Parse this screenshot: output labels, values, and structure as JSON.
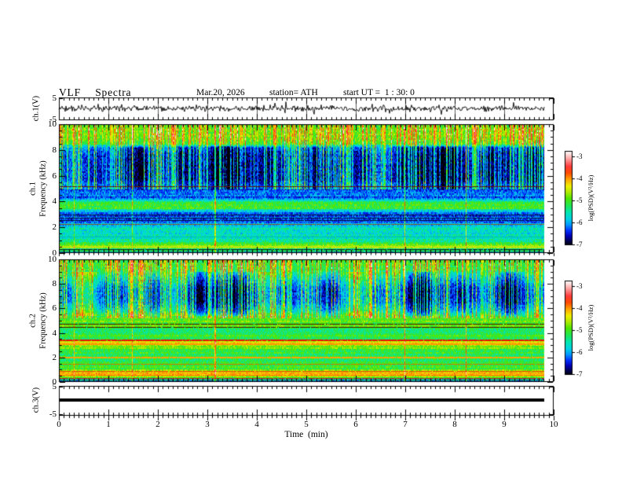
{
  "header": {
    "title": "VLF  Spectra",
    "date": "Mar.20, 2026",
    "station": "station= ATH",
    "start_ut": "start UT =  1 : 30: 0"
  },
  "x_axis": {
    "label": "Time  (min)",
    "min": 0,
    "max": 10,
    "minor_step": 0.1,
    "ticks": [
      "0",
      "1",
      "2",
      "3",
      "4",
      "5",
      "6",
      "7",
      "8",
      "9",
      "10"
    ],
    "data_end_min": 9.81
  },
  "colorbar": {
    "label": "log(PSD)(V²/Hz)",
    "ticks": [
      "-3",
      "-4",
      "-5",
      "-6",
      "-7"
    ],
    "tick_fracs": [
      0.06,
      0.2925,
      0.525,
      0.7575,
      0.99
    ],
    "vmin": -7,
    "vmax": -3
  },
  "palette": [
    [
      0.0,
      "#000000"
    ],
    [
      0.045,
      "#00004a"
    ],
    [
      0.1,
      "#0000b4"
    ],
    [
      0.16,
      "#0032ff"
    ],
    [
      0.22,
      "#0096ff"
    ],
    [
      0.28,
      "#00d2e6"
    ],
    [
      0.35,
      "#00e6b4"
    ],
    [
      0.42,
      "#1ee65a"
    ],
    [
      0.5,
      "#50e600"
    ],
    [
      0.57,
      "#b4eb00"
    ],
    [
      0.63,
      "#f0f000"
    ],
    [
      0.7,
      "#ffa500"
    ],
    [
      0.77,
      "#ff4b00"
    ],
    [
      0.84,
      "#ff3c3c"
    ],
    [
      0.91,
      "#ff9696"
    ],
    [
      0.96,
      "#ffd2d2"
    ],
    [
      1.0,
      "#ffffff"
    ]
  ],
  "events_seed": 2026,
  "tall_streak_density": 0.013,
  "chart_data": [
    {
      "id": "ch1_waveform",
      "type": "line",
      "ylabel": "ch.1(V)",
      "ylim": [
        -5,
        5
      ],
      "yticks": [
        "5",
        "-5"
      ],
      "description": "broadband noise trace centered on 0 V, typical amplitude ±1 V, spikes to ±3.5 V",
      "seed": 41,
      "sigma": 0.75,
      "spike_prob": 0.02
    },
    {
      "id": "ch1_spectrogram",
      "type": "heatmap",
      "ylabel_line1": "ch.1",
      "ylabel_line2": "Frequency  (kHz)",
      "ylim": [
        0,
        10
      ],
      "fmax": 10,
      "yticks": [
        "10",
        "8",
        "6",
        "4",
        "2",
        "0"
      ],
      "noise": 0.33,
      "seed": 7,
      "streaks": {
        "fmin": 5.0,
        "fmax": 10,
        "density": 0.5
      },
      "blob_amp": 0.35,
      "blob_range": [
        5.0,
        8.3
      ],
      "profile": [
        [
          0.0,
          -7.0
        ],
        [
          0.06,
          -6.9
        ],
        [
          0.12,
          -5.9
        ],
        [
          0.22,
          -5.3
        ],
        [
          0.32,
          -5.8
        ],
        [
          0.42,
          -4.9
        ],
        [
          0.55,
          -4.7
        ],
        [
          0.68,
          -5.1
        ],
        [
          0.85,
          -5.4
        ],
        [
          1.1,
          -5.55
        ],
        [
          1.5,
          -5.65
        ],
        [
          1.9,
          -5.55
        ],
        [
          2.1,
          -5.8
        ],
        [
          2.4,
          -6.15
        ],
        [
          2.7,
          -6.25
        ],
        [
          3.0,
          -6.2
        ],
        [
          3.3,
          -5.9
        ],
        [
          3.5,
          -5.15
        ],
        [
          3.9,
          -5.05
        ],
        [
          4.1,
          -5.7
        ],
        [
          4.4,
          -6.3
        ],
        [
          5.0,
          -6.4
        ],
        [
          5.3,
          -6.55
        ],
        [
          5.8,
          -6.75
        ],
        [
          7.2,
          -6.8
        ],
        [
          8.2,
          -6.55
        ],
        [
          8.5,
          -5.3
        ],
        [
          9.2,
          -5.0
        ],
        [
          9.7,
          -5.05
        ],
        [
          10.0,
          -5.25
        ]
      ],
      "lines": [
        {
          "f": 5.18,
          "color": "#6e1b00",
          "w": 0.09
        },
        {
          "f": 2.98,
          "color": "#001438",
          "w": 0.07
        },
        {
          "f": 2.76,
          "color": "#001438",
          "w": 0.07
        },
        {
          "f": 2.54,
          "color": "#00123a",
          "w": 0.06
        },
        {
          "f": 2.24,
          "color": "#8a5a22",
          "w": 0.08
        },
        {
          "f": 1.3,
          "color": "#00c896",
          "w": 0.05
        },
        {
          "f": 0.52,
          "color": "#b4e614",
          "w": 0.1
        },
        {
          "f": 0.3,
          "color": "#0a2800",
          "w": 0.08
        },
        {
          "f": 0.16,
          "color": "#2db400",
          "w": 0.07
        },
        {
          "f": 0.05,
          "color": "#000000",
          "w": 0.12
        }
      ]
    },
    {
      "id": "ch2_spectrogram",
      "type": "heatmap",
      "ylabel_line1": "ch.2",
      "ylabel_line2": "Frequency  (kHz)",
      "ylim": [
        0,
        10
      ],
      "fmax": 10,
      "yticks": [
        "10",
        "8",
        "6",
        "4",
        "2",
        "0"
      ],
      "noise": 0.3,
      "seed": 23,
      "streaks": {
        "fmin": 5.2,
        "fmax": 10,
        "density": 0.5
      },
      "blob_amp": 0.5,
      "blob_range": [
        5.4,
        9.0
      ],
      "profile": [
        [
          0.0,
          -7.0
        ],
        [
          0.05,
          -6.9
        ],
        [
          0.12,
          -6.2
        ],
        [
          0.25,
          -5.8
        ],
        [
          0.4,
          -5.2
        ],
        [
          0.55,
          -4.4
        ],
        [
          0.75,
          -4.15
        ],
        [
          0.95,
          -4.8
        ],
        [
          1.15,
          -5.25
        ],
        [
          1.5,
          -5.2
        ],
        [
          1.9,
          -5.15
        ],
        [
          2.3,
          -5.3
        ],
        [
          2.7,
          -5.25
        ],
        [
          3.0,
          -4.65
        ],
        [
          3.2,
          -4.5
        ],
        [
          3.5,
          -5.15
        ],
        [
          3.9,
          -5.3
        ],
        [
          4.3,
          -5.25
        ],
        [
          4.65,
          -5.05
        ],
        [
          5.1,
          -5.0
        ],
        [
          5.45,
          -5.5
        ],
        [
          5.9,
          -6.1
        ],
        [
          6.6,
          -6.5
        ],
        [
          7.6,
          -6.45
        ],
        [
          8.5,
          -6.0
        ],
        [
          9.1,
          -5.45
        ],
        [
          9.6,
          -5.3
        ],
        [
          10.0,
          -5.35
        ]
      ],
      "lines": [
        {
          "f": 4.72,
          "color": "#4b1600",
          "w": 0.07
        },
        {
          "f": 4.5,
          "color": "#4b1600",
          "w": 0.07
        },
        {
          "f": 3.42,
          "color": "#e61400",
          "w": 0.1
        },
        {
          "f": 3.12,
          "color": "#ff9b00",
          "w": 0.1
        },
        {
          "f": 2.02,
          "color": "#ffa000",
          "w": 0.08
        },
        {
          "f": 1.45,
          "color": "#c87800",
          "w": 0.05
        },
        {
          "f": 0.88,
          "color": "#e63c00",
          "w": 0.09
        },
        {
          "f": 0.7,
          "color": "#ffc800",
          "w": 0.09
        },
        {
          "f": 0.55,
          "color": "#ff6400",
          "w": 0.07
        },
        {
          "f": 0.34,
          "color": "#c81e00",
          "w": 0.06
        },
        {
          "f": 0.2,
          "color": "#1ea000",
          "w": 0.06
        },
        {
          "f": 0.06,
          "color": "#000000",
          "w": 0.12
        }
      ]
    },
    {
      "id": "ch3_waveform",
      "type": "line",
      "ylabel": "ch.3(V)",
      "ylim": [
        -5,
        5
      ],
      "yticks": [
        "5",
        "-5"
      ],
      "description": "constant 0 V flat line, thick stroke",
      "value": 0,
      "thickness": 4
    }
  ]
}
